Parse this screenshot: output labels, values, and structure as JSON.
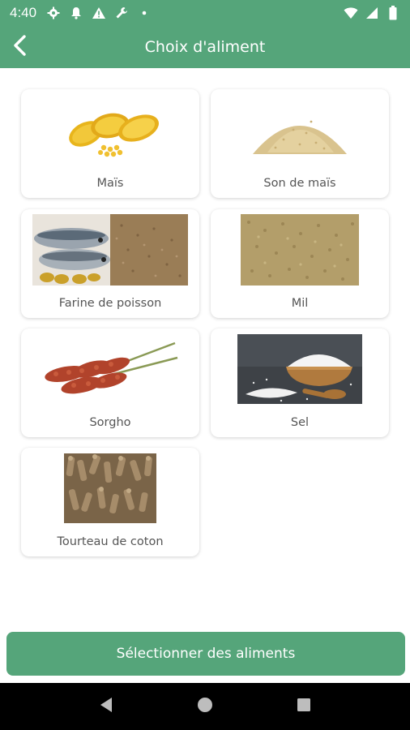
{
  "status_bar": {
    "time": "4:40",
    "left_icons": [
      "gear-icon",
      "bell-icon",
      "warning-icon",
      "wrench-icon",
      "dot-icon"
    ],
    "right_icons": [
      "wifi-icon",
      "signal-icon",
      "battery-icon"
    ]
  },
  "app_bar": {
    "title": "Choix d'aliment",
    "back_icon": "chevron-left-icon"
  },
  "foods": [
    {
      "label": "Maïs"
    },
    {
      "label": "Son de maïs"
    },
    {
      "label": "Farine de poisson"
    },
    {
      "label": "Mil"
    },
    {
      "label": "Sorgho"
    },
    {
      "label": "Sel"
    },
    {
      "label": "Tourteau de coton"
    }
  ],
  "action": {
    "select_label": "Sélectionner des aliments"
  },
  "nav_bar": {
    "icons": [
      "back-triangle-icon",
      "home-circle-icon",
      "recents-square-icon"
    ]
  },
  "colors": {
    "primary": "#55a57a",
    "card_bg": "#ffffff",
    "label_text": "#555555"
  }
}
